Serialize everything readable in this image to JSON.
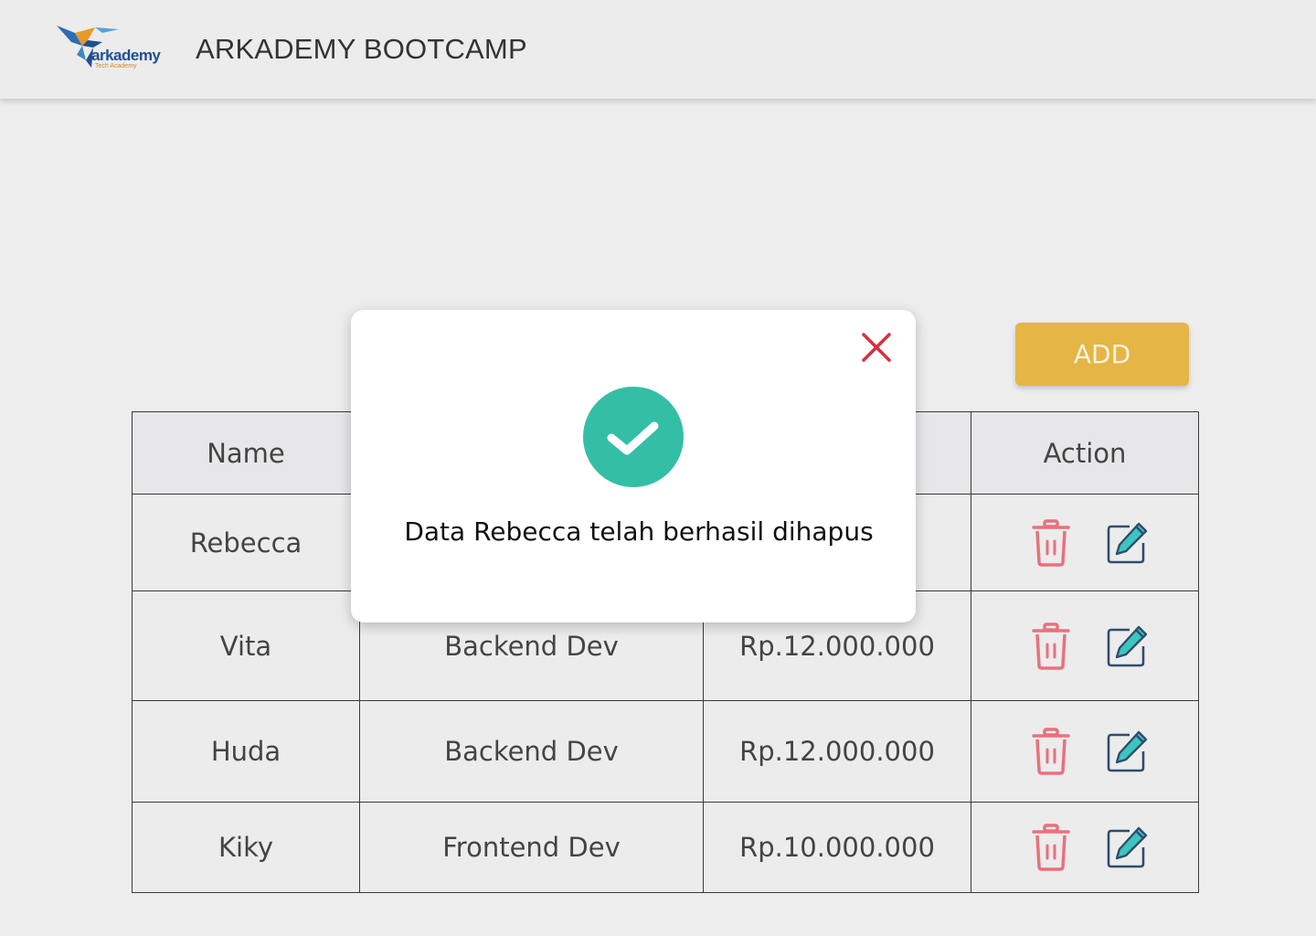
{
  "header": {
    "logo_text": "arkademy",
    "logo_tagline": "Tech Academy",
    "title": "ARKADEMY BOOTCAMP"
  },
  "toolbar": {
    "add_label": "ADD"
  },
  "table": {
    "columns": [
      "Name",
      "",
      "",
      "Action"
    ],
    "rows": [
      {
        "name": "Rebecca",
        "role": "",
        "salary": ""
      },
      {
        "name": "Vita",
        "role": "Backend Dev",
        "salary": "Rp.12.000.000"
      },
      {
        "name": "Huda",
        "role": "Backend Dev",
        "salary": "Rp.12.000.000"
      },
      {
        "name": "Kiky",
        "role": "Frontend Dev",
        "salary": "Rp.10.000.000"
      }
    ]
  },
  "modal": {
    "message": "Data Rebecca telah berhasil dihapus",
    "icon": "check-circle-icon",
    "close_icon": "close-icon"
  },
  "colors": {
    "accent": "#e5b545",
    "success": "#33bfa5",
    "danger": "#e8717d",
    "close": "#d9303f",
    "edit": "#2f4d6e"
  }
}
